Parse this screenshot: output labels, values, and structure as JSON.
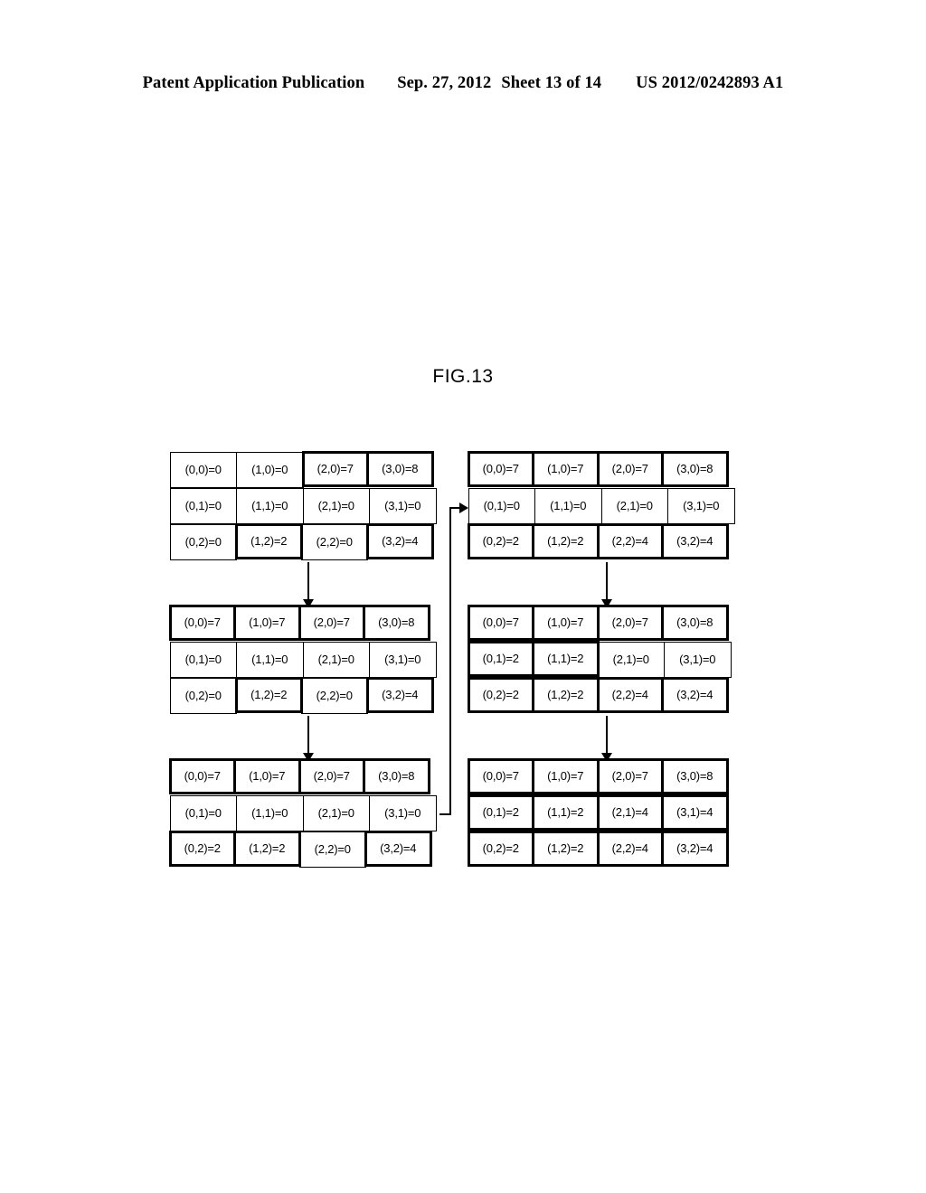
{
  "header": {
    "publication": "Patent Application Publication",
    "date": "Sep. 27, 2012",
    "sheet": "Sheet 13 of 14",
    "patent_number": "US 2012/0242893 A1"
  },
  "figure": {
    "label": "FIG.13"
  },
  "diagram": {
    "type": "data-flow-grid-sequence",
    "grid_columns": 4,
    "grid_rows": 3,
    "grids": [
      {
        "id": "grid-0",
        "position": "top-left",
        "rows": [
          [
            {
              "text": "(0,0)=0",
              "bold": false
            },
            {
              "text": "(1,0)=0",
              "bold": false
            },
            {
              "text": "(2,0)=7",
              "bold": true
            },
            {
              "text": "(3,0)=8",
              "bold": true
            }
          ],
          [
            {
              "text": "(0,1)=0",
              "bold": false
            },
            {
              "text": "(1,1)=0",
              "bold": false
            },
            {
              "text": "(2,1)=0",
              "bold": false
            },
            {
              "text": "(3,1)=0",
              "bold": false
            }
          ],
          [
            {
              "text": "(0,2)=0",
              "bold": false
            },
            {
              "text": "(1,2)=2",
              "bold": true
            },
            {
              "text": "(2,2)=0",
              "bold": false
            },
            {
              "text": "(3,2)=4",
              "bold": true
            }
          ]
        ]
      },
      {
        "id": "grid-1",
        "position": "top-right",
        "rows": [
          [
            {
              "text": "(0,0)=7",
              "bold": true
            },
            {
              "text": "(1,0)=7",
              "bold": true
            },
            {
              "text": "(2,0)=7",
              "bold": true
            },
            {
              "text": "(3,0)=8",
              "bold": true
            }
          ],
          [
            {
              "text": "(0,1)=0",
              "bold": false
            },
            {
              "text": "(1,1)=0",
              "bold": false
            },
            {
              "text": "(2,1)=0",
              "bold": false
            },
            {
              "text": "(3,1)=0",
              "bold": false
            }
          ],
          [
            {
              "text": "(0,2)=2",
              "bold": true
            },
            {
              "text": "(1,2)=2",
              "bold": true
            },
            {
              "text": "(2,2)=4",
              "bold": true
            },
            {
              "text": "(3,2)=4",
              "bold": true
            }
          ]
        ]
      },
      {
        "id": "grid-2",
        "position": "middle-left",
        "rows": [
          [
            {
              "text": "(0,0)=7",
              "bold": true
            },
            {
              "text": "(1,0)=7",
              "bold": true
            },
            {
              "text": "(2,0)=7",
              "bold": true
            },
            {
              "text": "(3,0)=8",
              "bold": true
            }
          ],
          [
            {
              "text": "(0,1)=0",
              "bold": false
            },
            {
              "text": "(1,1)=0",
              "bold": false
            },
            {
              "text": "(2,1)=0",
              "bold": false
            },
            {
              "text": "(3,1)=0",
              "bold": false
            }
          ],
          [
            {
              "text": "(0,2)=0",
              "bold": false
            },
            {
              "text": "(1,2)=2",
              "bold": true
            },
            {
              "text": "(2,2)=0",
              "bold": false
            },
            {
              "text": "(3,2)=4",
              "bold": true
            }
          ]
        ]
      },
      {
        "id": "grid-3",
        "position": "middle-right",
        "rows": [
          [
            {
              "text": "(0,0)=7",
              "bold": true
            },
            {
              "text": "(1,0)=7",
              "bold": true
            },
            {
              "text": "(2,0)=7",
              "bold": true
            },
            {
              "text": "(3,0)=8",
              "bold": true
            }
          ],
          [
            {
              "text": "(0,1)=2",
              "bold": true
            },
            {
              "text": "(1,1)=2",
              "bold": true
            },
            {
              "text": "(2,1)=0",
              "bold": false
            },
            {
              "text": "(3,1)=0",
              "bold": false
            }
          ],
          [
            {
              "text": "(0,2)=2",
              "bold": true
            },
            {
              "text": "(1,2)=2",
              "bold": true
            },
            {
              "text": "(2,2)=4",
              "bold": true
            },
            {
              "text": "(3,2)=4",
              "bold": true
            }
          ]
        ]
      },
      {
        "id": "grid-4",
        "position": "bottom-left",
        "rows": [
          [
            {
              "text": "(0,0)=7",
              "bold": true
            },
            {
              "text": "(1,0)=7",
              "bold": true
            },
            {
              "text": "(2,0)=7",
              "bold": true
            },
            {
              "text": "(3,0)=8",
              "bold": true
            }
          ],
          [
            {
              "text": "(0,1)=0",
              "bold": false
            },
            {
              "text": "(1,1)=0",
              "bold": false
            },
            {
              "text": "(2,1)=0",
              "bold": false
            },
            {
              "text": "(3,1)=0",
              "bold": false
            }
          ],
          [
            {
              "text": "(0,2)=2",
              "bold": true
            },
            {
              "text": "(1,2)=2",
              "bold": true
            },
            {
              "text": "(2,2)=0",
              "bold": false
            },
            {
              "text": "(3,2)=4",
              "bold": true
            }
          ]
        ]
      },
      {
        "id": "grid-5",
        "position": "bottom-right",
        "rows": [
          [
            {
              "text": "(0,0)=7",
              "bold": true
            },
            {
              "text": "(1,0)=7",
              "bold": true
            },
            {
              "text": "(2,0)=7",
              "bold": true
            },
            {
              "text": "(3,0)=8",
              "bold": true
            }
          ],
          [
            {
              "text": "(0,1)=2",
              "bold": true
            },
            {
              "text": "(1,1)=2",
              "bold": true
            },
            {
              "text": "(2,1)=4",
              "bold": true
            },
            {
              "text": "(3,1)=4",
              "bold": true
            }
          ],
          [
            {
              "text": "(0,2)=2",
              "bold": true
            },
            {
              "text": "(1,2)=2",
              "bold": true
            },
            {
              "text": "(2,2)=4",
              "bold": true
            },
            {
              "text": "(3,2)=4",
              "bold": true
            }
          ]
        ]
      }
    ],
    "connectors": [
      {
        "id": "arrow-g0-g2",
        "from": "grid-0",
        "to": "grid-2",
        "kind": "down-arrow"
      },
      {
        "id": "arrow-g2-g4",
        "from": "grid-2",
        "to": "grid-4",
        "kind": "down-arrow"
      },
      {
        "id": "arrow-g1-g3",
        "from": "grid-1",
        "to": "grid-3",
        "kind": "down-arrow"
      },
      {
        "id": "arrow-g3-g5",
        "from": "grid-3",
        "to": "grid-5",
        "kind": "down-arrow"
      },
      {
        "id": "feedback",
        "from": "grid-4",
        "to": "grid-1",
        "kind": "elbow-arrow"
      }
    ],
    "colors": {
      "line": "#000000",
      "cell_background": "#ffffff",
      "text": "#000000"
    }
  }
}
